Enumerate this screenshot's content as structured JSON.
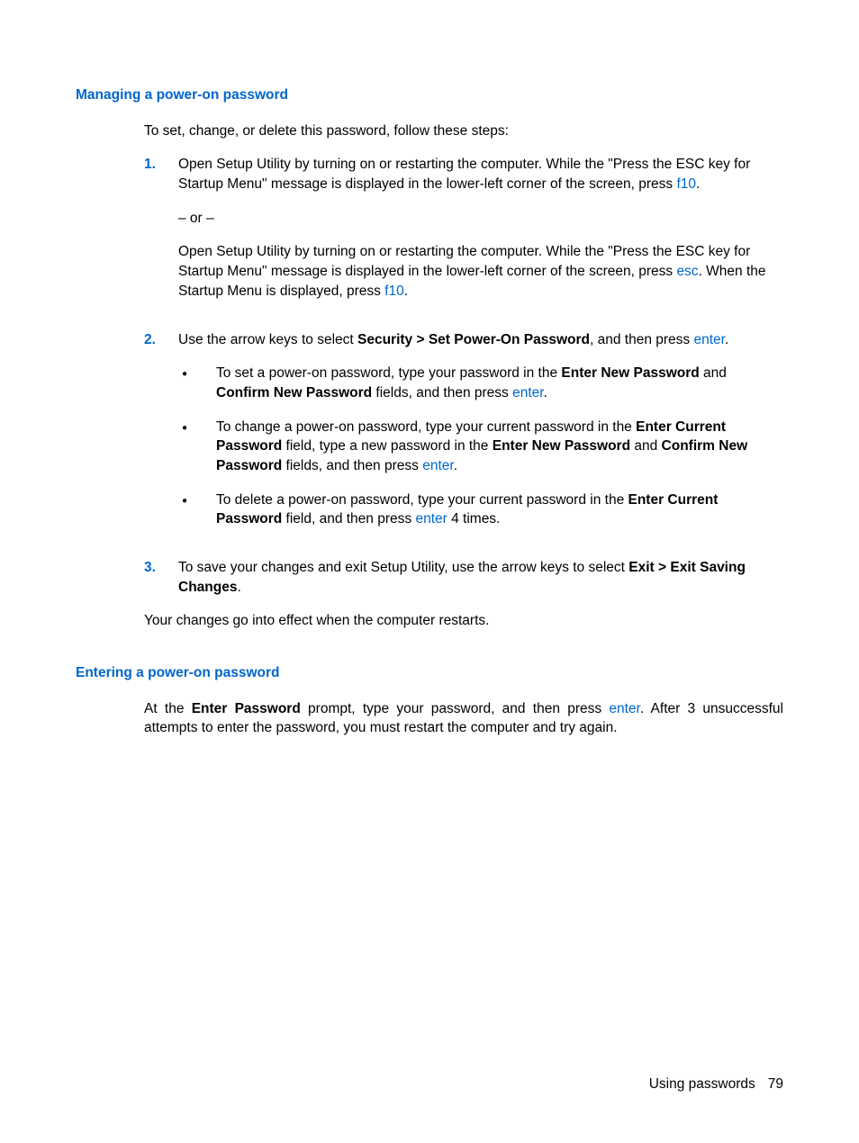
{
  "section1": {
    "heading": "Managing a power-on password",
    "intro": "To set, change, or delete this password, follow these steps:",
    "step1": {
      "num": "1.",
      "p1a": "Open Setup Utility by turning on or restarting the computer. While the \"Press the ESC key for Startup Menu\" message is displayed in the lower-left corner of the screen, press ",
      "p1_key": "f10",
      "p1b": ".",
      "or": "– or –",
      "p2a": "Open Setup Utility by turning on or restarting the computer. While the \"Press the ESC key for Startup Menu\" message is displayed in the lower-left corner of the screen, press ",
      "p2_key1": "esc",
      "p2b": ". When the Startup Menu is displayed, press ",
      "p2_key2": "f10",
      "p2c": "."
    },
    "step2": {
      "num": "2.",
      "lead_a": "Use the arrow keys to select ",
      "lead_bold": "Security > Set Power-On Password",
      "lead_b": ", and then press ",
      "lead_key": "enter",
      "lead_c": ".",
      "b1": {
        "t1": "To set a power-on password, type your password in the ",
        "b1": "Enter New Password",
        "t2": " and ",
        "b2": "Confirm New Password",
        "t3": " fields, and then press ",
        "k": "enter",
        "t4": "."
      },
      "b2": {
        "t1": "To change a power-on password, type your current password in the ",
        "b1": "Enter Current Password",
        "t2": " field, type a new password in the ",
        "b2": "Enter New Password",
        "t3": " and ",
        "b3": "Confirm New Password",
        "t4": " fields, and then press ",
        "k": "enter",
        "t5": "."
      },
      "b3": {
        "t1": "To delete a power-on password, type your current password in the ",
        "b1": "Enter Current Password",
        "t2": " field, and then press ",
        "k": "enter",
        "t3": " 4 times."
      }
    },
    "step3": {
      "num": "3.",
      "t1": "To save your changes and exit Setup Utility, use the arrow keys to select ",
      "b1": "Exit > Exit Saving Changes",
      "t2": "."
    },
    "outro": "Your changes go into effect when the computer restarts."
  },
  "section2": {
    "heading": "Entering a power-on password",
    "p": {
      "t1": "At the ",
      "b1": "Enter Password",
      "t2": " prompt, type your password, and then press ",
      "k": "enter",
      "t3": ". After 3 unsuccessful attempts to enter the password, you must restart the computer and try again."
    }
  },
  "footer": {
    "section": "Using passwords",
    "page": "79"
  }
}
